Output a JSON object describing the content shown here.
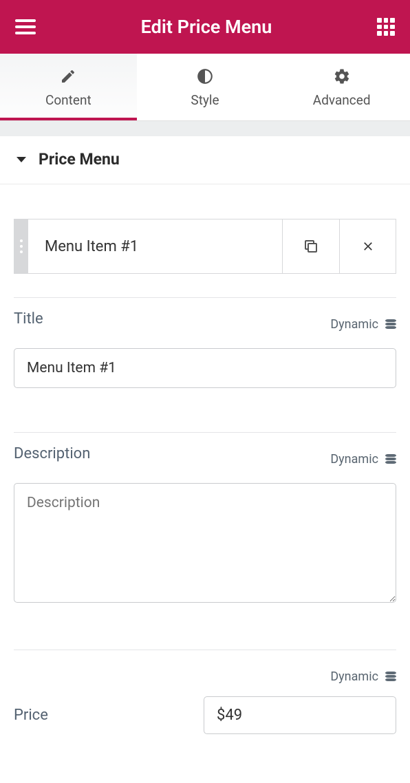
{
  "header": {
    "title": "Edit Price Menu"
  },
  "tabs": {
    "content": "Content",
    "style": "Style",
    "advanced": "Advanced"
  },
  "section": {
    "title": "Price Menu"
  },
  "item": {
    "title": "Menu Item #1"
  },
  "fields": {
    "title": {
      "label": "Title",
      "dynamic": "Dynamic",
      "value": "Menu Item #1"
    },
    "description": {
      "label": "Description",
      "dynamic": "Dynamic",
      "placeholder": "Description",
      "value": ""
    },
    "price": {
      "label": "Price",
      "dynamic": "Dynamic",
      "value": "$49"
    }
  }
}
